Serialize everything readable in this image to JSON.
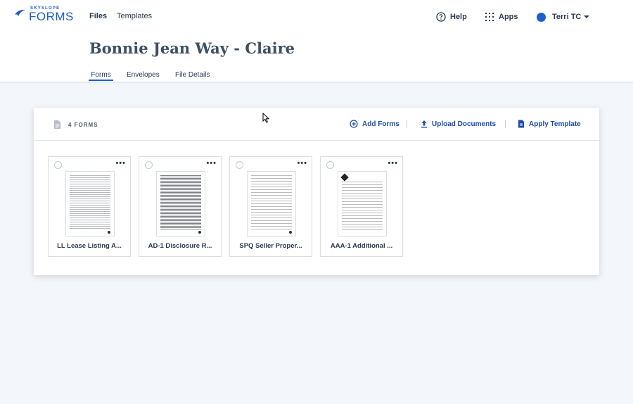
{
  "brand": {
    "sup": "SKYSLOPE",
    "main": "FORMS",
    "color": "#1c5fc9"
  },
  "nav": {
    "files": "Files",
    "templates": "Templates"
  },
  "header_actions": {
    "help": "Help",
    "apps": "Apps",
    "user": "Terri TC"
  },
  "page": {
    "title": "Bonnie Jean Way - Claire"
  },
  "tabs": [
    {
      "label": "Forms",
      "active": true
    },
    {
      "label": "Envelopes",
      "active": false
    },
    {
      "label": "File Details",
      "active": false
    }
  ],
  "forms_panel": {
    "count_label": "4 FORMS",
    "actions": {
      "add": "Add Forms",
      "upload": "Upload Documents",
      "template": "Apply Template"
    },
    "forms": [
      {
        "name": "LL Lease Listing A..."
      },
      {
        "name": "AD-1 Disclosure R..."
      },
      {
        "name": "SPQ Seller Proper..."
      },
      {
        "name": "AAA-1 Additional ..."
      }
    ]
  }
}
